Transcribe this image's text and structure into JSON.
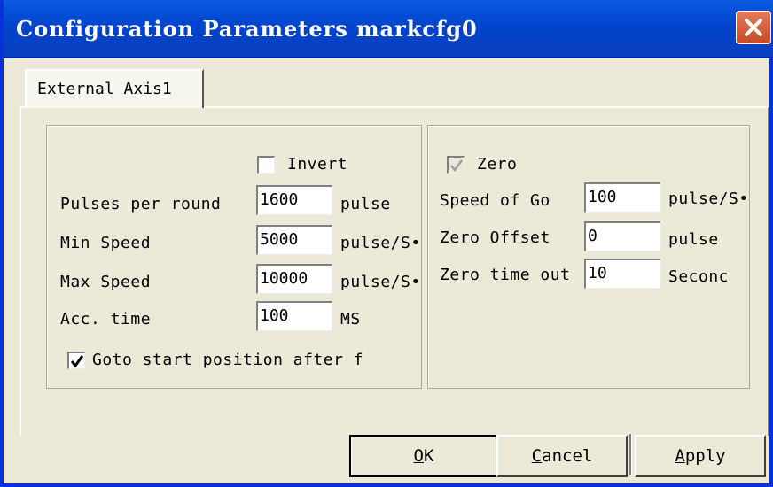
{
  "window": {
    "title": "Configuration Parameters markcfg0"
  },
  "tabs": [
    {
      "label": "External Axis1",
      "selected": true
    }
  ],
  "left_group": {
    "invert": {
      "label": "Invert",
      "checked": false
    },
    "pulses_per_round": {
      "label": "Pulses per round",
      "value": "1600",
      "unit": "pulse"
    },
    "min_speed": {
      "label": "Min Speed",
      "value": "5000",
      "unit": "pulse/S•"
    },
    "max_speed": {
      "label": "Max Speed",
      "value": "10000",
      "unit": "pulse/S•"
    },
    "acc_time": {
      "label": "Acc. time",
      "value": "100",
      "unit": "MS"
    },
    "goto_start": {
      "label": "Goto start position after f",
      "checked": true
    }
  },
  "right_group": {
    "zero": {
      "label": "Zero",
      "checked": true,
      "disabled": true
    },
    "speed_of_go": {
      "label": "Speed of Go",
      "value": "100",
      "unit": "pulse/S•"
    },
    "zero_offset": {
      "label": "Zero Offset",
      "value": "0",
      "unit": "pulse"
    },
    "zero_time_out": {
      "label": "Zero time out",
      "value": "10",
      "unit": "Seconc"
    }
  },
  "buttons": {
    "ok": {
      "mnemonic": "O",
      "rest": "K"
    },
    "cancel": {
      "mnemonic": "C",
      "rest": "ancel"
    },
    "apply": {
      "mnemonic": "A",
      "rest": "pply"
    }
  },
  "colors": {
    "titlebar": "#0044cc",
    "face": "#ece9d8",
    "close": "#c44a24"
  }
}
